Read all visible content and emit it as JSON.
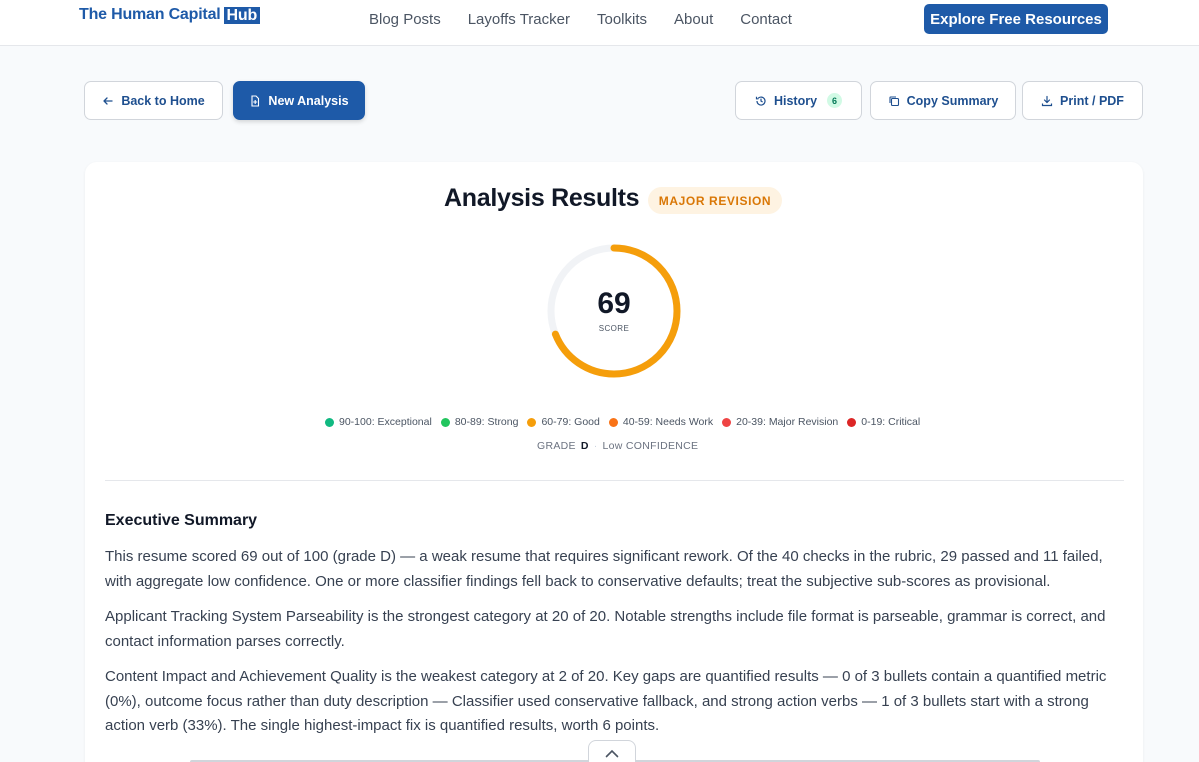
{
  "nav": {
    "logo_main": "The Human Capital",
    "logo_hub": "Hub",
    "links": [
      "Blog Posts",
      "Layoffs Tracker",
      "Toolkits",
      "About",
      "Contact"
    ],
    "cta": "Explore Free Resources"
  },
  "actions": {
    "back": "Back to Home",
    "new_analysis": "New Analysis",
    "history": "History",
    "history_count": "6",
    "copy": "Copy Summary",
    "print": "Print / PDF"
  },
  "results": {
    "title": "Analysis Results",
    "verdict": "MAJOR REVISION",
    "score": "69",
    "score_label": "SCORE",
    "score_fraction": 0.69,
    "gauge_color": "#f59e0b",
    "grade_prefix": "GRADE",
    "grade": "D",
    "confidence": "Low CONFIDENCE",
    "legend": [
      {
        "label": "90-100: Exceptional",
        "color": "#10b981"
      },
      {
        "label": "80-89: Strong",
        "color": "#22c55e"
      },
      {
        "label": "60-79: Good",
        "color": "#f59e0b"
      },
      {
        "label": "40-59: Needs Work",
        "color": "#f97316"
      },
      {
        "label": "20-39: Major Revision",
        "color": "#ef4444"
      },
      {
        "label": "0-19: Critical",
        "color": "#dc2626"
      }
    ]
  },
  "summary": {
    "heading": "Executive Summary",
    "p1": "This resume scored 69 out of 100 (grade D) — a weak resume that requires significant rework. Of the 40 checks in the rubric, 29 passed and 11 failed, with aggregate low confidence. One or more classifier findings fell back to conservative defaults; treat the subjective sub-scores as provisional.",
    "p2": "Applicant Tracking System Parseability is the strongest category at 20 of 20. Notable strengths include file format is parseable, grammar is correct, and contact information parses correctly.",
    "p3": "Content Impact and Achievement Quality is the weakest category at 2 of 20. Key gaps are quantified results — 0 of 3 bullets contain a quantified metric (0%), outcome focus rather than duty description — Classifier used conservative fallback, and strong action verbs — 1 of 3 bullets start with a strong action verb (33%). The single highest-impact fix is quantified results, worth 6 points."
  }
}
